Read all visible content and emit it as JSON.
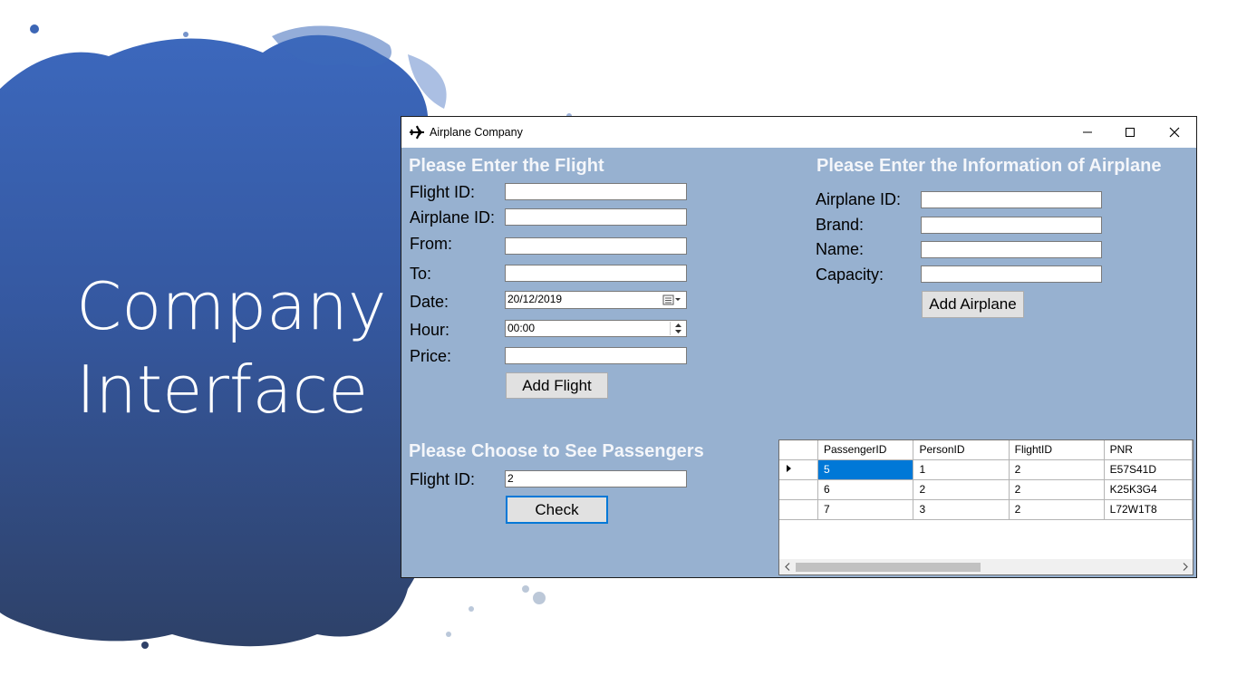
{
  "slide": {
    "title_line1": "Company",
    "title_line2": "Interface"
  },
  "window": {
    "title": "Airplane Company",
    "icon": "airplane-icon"
  },
  "flight_form": {
    "heading": "Please Enter the Flight",
    "flight_id_label": "Flight ID:",
    "flight_id_value": "",
    "airplane_id_label": "Airplane ID:",
    "airplane_id_value": "",
    "from_label": "From:",
    "from_value": "",
    "to_label": "To:",
    "to_value": "",
    "date_label": "Date:",
    "date_value": "20/12/2019",
    "hour_label": "Hour:",
    "hour_value": "00:00",
    "price_label": "Price:",
    "price_value": "",
    "add_button": "Add Flight"
  },
  "airplane_form": {
    "heading": "Please Enter the Information of Airplane",
    "airplane_id_label": "Airplane ID:",
    "brand_label": "Brand:",
    "name_label": "Name:",
    "capacity_label": "Capacity:",
    "add_button": "Add Airplane"
  },
  "passengers": {
    "heading": "Please Choose to See Passengers",
    "flight_id_label": "Flight ID:",
    "flight_id_value": "2",
    "check_button": "Check",
    "columns": [
      "PassengerID",
      "PersonID",
      "FlightID",
      "PNR"
    ],
    "rows": [
      [
        "5",
        "1",
        "2",
        "E57S41D"
      ],
      [
        "6",
        "2",
        "2",
        "K25K3G4"
      ],
      [
        "7",
        "3",
        "2",
        "L72W1T8"
      ]
    ]
  },
  "colors": {
    "window_bg": "#97b1d0",
    "selection": "#0078d7",
    "splash_top": "#3a66b8",
    "splash_bottom": "#2f4670"
  }
}
